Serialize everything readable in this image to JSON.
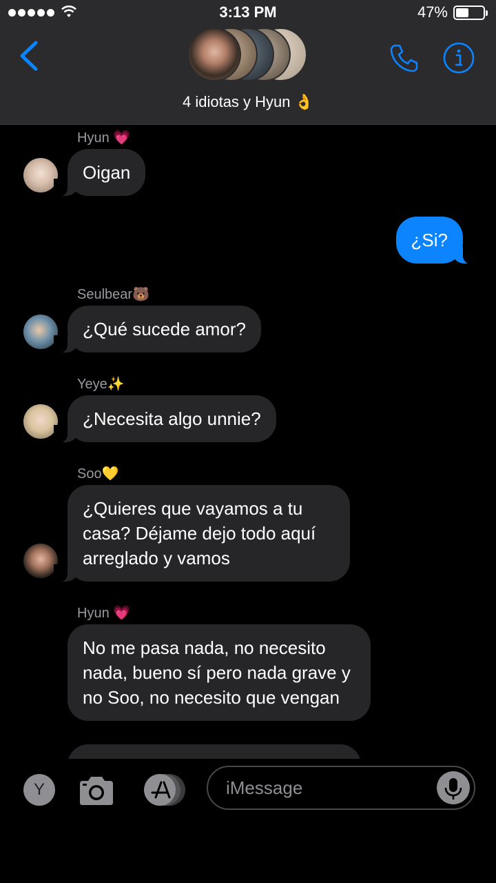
{
  "status": {
    "time": "3:13 PM",
    "battery": "47%"
  },
  "header": {
    "title": "4 idiotas y Hyun 👌"
  },
  "messages": [
    {
      "sender": "Hyun 💗",
      "text": "Oigan"
    },
    {
      "text": "¿Si?"
    },
    {
      "sender": "Seulbear🐻",
      "text": "¿Qué sucede amor?"
    },
    {
      "sender": "Yeye✨",
      "text": "¿Necesita algo unnie?"
    },
    {
      "sender": "Soo💛",
      "text": "¿Quieres que vayamos a tu casa? Déjame dejo todo aquí arreglado y vamos"
    },
    {
      "sender": "Hyun 💗",
      "text": "No me pasa nada, no necesito nada, bueno sí pero nada grave y no Soo, no necesito que vengan"
    }
  ],
  "composer": {
    "avatar_letter": "Y",
    "placeholder": "iMessage"
  },
  "colors": {
    "accent": "#0b84fe",
    "incoming_bubble": "#262628",
    "header_bg": "#2b2b2d"
  },
  "icons": [
    "back-chevron-icon",
    "phone-icon",
    "info-icon",
    "camera-icon",
    "app-store-icon",
    "microphone-icon",
    "wifi-icon",
    "battery-icon"
  ]
}
